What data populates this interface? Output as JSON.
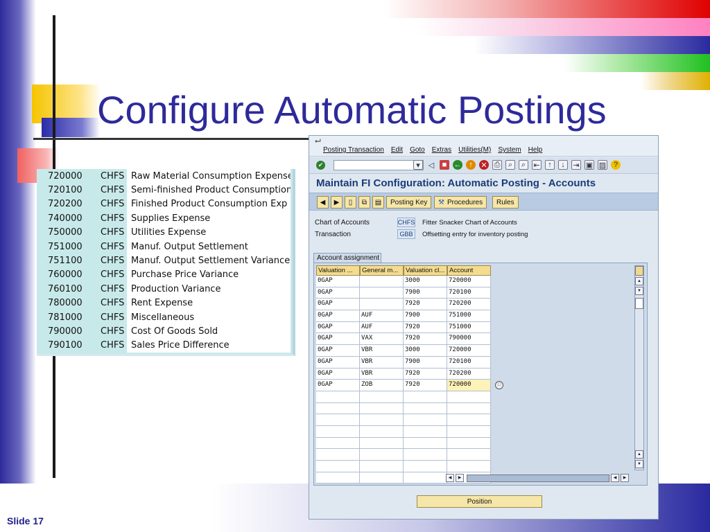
{
  "slide": {
    "title": "Configure Automatic Postings",
    "number": "Slide 17"
  },
  "accounts": [
    {
      "number": "720000",
      "chart": "CHFS",
      "description": "Raw Material Consumption Expense"
    },
    {
      "number": "720100",
      "chart": "CHFS",
      "description": "Semi-finished Product Consumption Exp"
    },
    {
      "number": "720200",
      "chart": "CHFS",
      "description": "Finished Product Consumption Exp"
    },
    {
      "number": "740000",
      "chart": "CHFS",
      "description": "Supplies Expense"
    },
    {
      "number": "750000",
      "chart": "CHFS",
      "description": "Utilities Expense"
    },
    {
      "number": "751000",
      "chart": "CHFS",
      "description": "Manuf. Output Settlement"
    },
    {
      "number": "751100",
      "chart": "CHFS",
      "description": "Manuf. Output Settlement Variance"
    },
    {
      "number": "760000",
      "chart": "CHFS",
      "description": "Purchase Price Variance"
    },
    {
      "number": "760100",
      "chart": "CHFS",
      "description": "Production Variance"
    },
    {
      "number": "780000",
      "chart": "CHFS",
      "description": "Rent Expense"
    },
    {
      "number": "781000",
      "chart": "CHFS",
      "description": "Miscellaneous"
    },
    {
      "number": "790000",
      "chart": "CHFS",
      "description": "Cost Of Goods Sold"
    },
    {
      "number": "790100",
      "chart": "CHFS",
      "description": "Sales Price Difference"
    }
  ],
  "sap": {
    "menu": [
      "Posting Transaction",
      "Edit",
      "Goto",
      "Extras",
      "Utilities(M)",
      "System",
      "Help"
    ],
    "screen_title": "Maintain FI Configuration: Automatic Posting - Accounts",
    "app_buttons": {
      "posting_key": "Posting Key",
      "procedures": "Procedures",
      "rules": "Rules"
    },
    "chart_of_accounts": {
      "label": "Chart of Accounts",
      "value": "CHFS",
      "description": "Fitter Snacker Chart of Accounts"
    },
    "transaction": {
      "label": "Transaction",
      "value": "GBB",
      "description": "Offsetting entry for inventory posting"
    },
    "assignment_tab": "Account assignment",
    "columns": [
      "Valuation ...",
      "General m...",
      "Valuation cl...",
      "Account"
    ],
    "rows": [
      [
        "0GAP",
        "",
        "3000",
        "720000"
      ],
      [
        "0GAP",
        "",
        "7900",
        "720100"
      ],
      [
        "0GAP",
        "",
        "7920",
        "720200"
      ],
      [
        "0GAP",
        "AUF",
        "7900",
        "751000"
      ],
      [
        "0GAP",
        "AUF",
        "7920",
        "751000"
      ],
      [
        "0GAP",
        "VAX",
        "7920",
        "790000"
      ],
      [
        "0GAP",
        "VBR",
        "3000",
        "720000"
      ],
      [
        "0GAP",
        "VBR",
        "7900",
        "720100"
      ],
      [
        "0GAP",
        "VBR",
        "7920",
        "720200"
      ],
      [
        "0GAP",
        "ZOB",
        "7920",
        "720000"
      ]
    ],
    "empty_rows": 8,
    "position_button": "Position"
  }
}
